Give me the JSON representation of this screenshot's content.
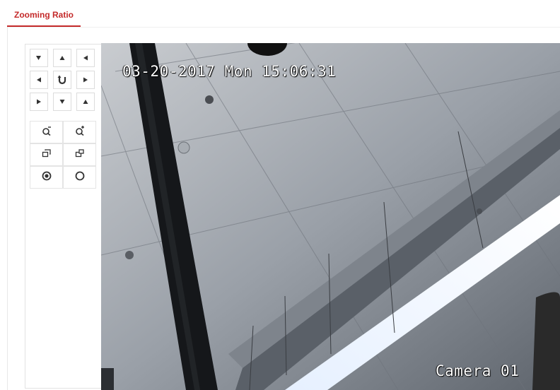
{
  "tabs": [
    {
      "label": "Zooming Ratio",
      "active": true
    }
  ],
  "ptz": {
    "direction_buttons": [
      {
        "icon": "arrow-up-left-icon",
        "name": "pan-up-left-button"
      },
      {
        "icon": "arrow-up-icon",
        "name": "pan-up-button"
      },
      {
        "icon": "arrow-up-right-icon",
        "name": "pan-up-right-button"
      },
      {
        "icon": "arrow-left-icon",
        "name": "pan-left-button"
      },
      {
        "icon": "auto-rotate-icon",
        "name": "auto-pan-button"
      },
      {
        "icon": "arrow-right-icon",
        "name": "pan-right-button"
      },
      {
        "icon": "arrow-down-left-icon",
        "name": "pan-down-left-button"
      },
      {
        "icon": "arrow-down-icon",
        "name": "pan-down-button"
      },
      {
        "icon": "arrow-down-right-icon",
        "name": "pan-down-right-button"
      }
    ],
    "lens_buttons": [
      {
        "icon": "zoom-out-icon",
        "name": "zoom-out-button"
      },
      {
        "icon": "zoom-in-icon",
        "name": "zoom-in-button"
      },
      {
        "icon": "focus-near-icon",
        "name": "focus-near-button"
      },
      {
        "icon": "focus-far-icon",
        "name": "focus-far-button"
      },
      {
        "icon": "iris-close-icon",
        "name": "iris-close-button"
      },
      {
        "icon": "iris-open-icon",
        "name": "iris-open-button"
      }
    ]
  },
  "video": {
    "timestamp_osd": "03-20-2017 Mon 15:06:31",
    "camera_name_osd": "Camera 01"
  },
  "colors": {
    "accent": "#c42a2a",
    "border": "#e2e2e2",
    "icon": "#333333"
  }
}
